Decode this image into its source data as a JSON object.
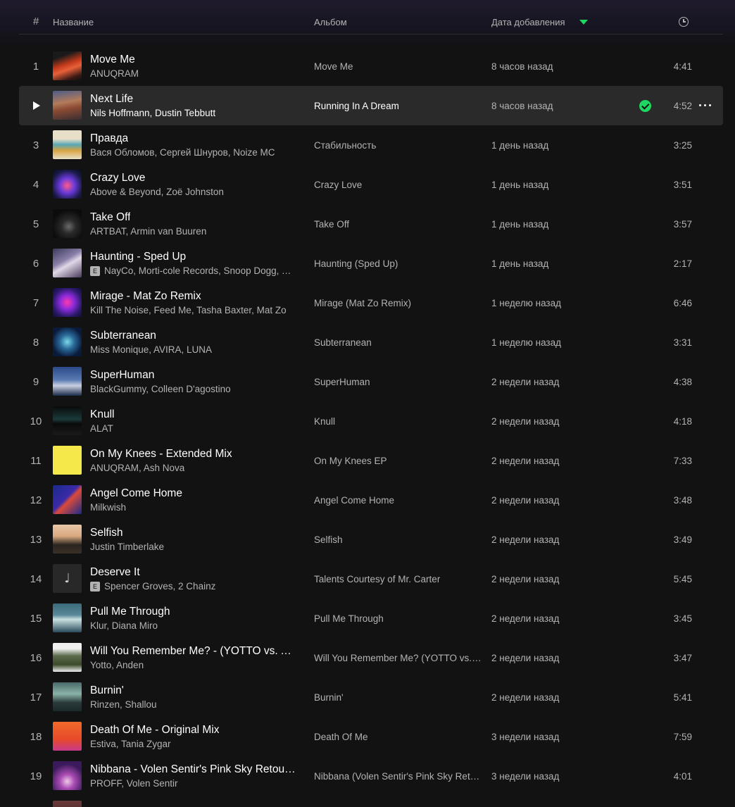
{
  "header": {
    "num": "#",
    "title": "Название",
    "album": "Альбом",
    "date": "Дата добавления"
  },
  "tracks": [
    {
      "num": "1",
      "title": "Move Me",
      "artist": "ANUQRAM",
      "album": "Move Me",
      "date": "8 часов назад",
      "duration": "4:41",
      "explicit": false,
      "cover": "linear-gradient(160deg,#1a1a1a 0%,#1a1a1a 20%,#c23a1a 45%,#e8603a 60%,#3a1a14 85%,#111 100%)"
    },
    {
      "num": "2",
      "title": "Next Life",
      "artist": "Nils Hoffmann, Dustin Tebbutt",
      "album": "Running In A Dream",
      "date": "8 часов назад",
      "duration": "4:52",
      "explicit": false,
      "active": true,
      "saved": true,
      "cover": "linear-gradient(170deg,#4a5c8a 0%,#b37b5a 40%,#8c4b33 60%,#3a2e30 100%)"
    },
    {
      "num": "3",
      "title": "Правда",
      "artist": "Вася Обломов, Сергей Шнуров, Noize MC",
      "album": "Стабильность",
      "date": "1 день назад",
      "duration": "3:25",
      "explicit": false,
      "cover": "linear-gradient(180deg,#e8dfc8 0%,#e8dfc8 30%,#58a6b3 50%,#d9a441 70%,#e8dfc8 100%)"
    },
    {
      "num": "4",
      "title": "Crazy Love",
      "artist": "Above & Beyond, Zoë Johnston",
      "album": "Crazy Love",
      "date": "1 день назад",
      "duration": "3:51",
      "explicit": false,
      "cover": "radial-gradient(circle at 50% 55%,#ff5a8a 0%,#6a3ad9 35%,#1a1a4a 70%,#0a0a1a 100%)"
    },
    {
      "num": "5",
      "title": "Take Off",
      "artist": "ARTBAT, Armin van Buuren",
      "album": "Take Off",
      "date": "1 день назад",
      "duration": "3:57",
      "explicit": false,
      "cover": "radial-gradient(circle at 55% 60%,#6a6a6a 0%,#2a2a2a 30%,#0c0c0c 70%)"
    },
    {
      "num": "6",
      "title": "Haunting - Sped Up",
      "artist": "NayCo, Morti-cole Records, Snoop Dogg, Trippie Redd",
      "album": "Haunting (Sped Up)",
      "date": "1 день назад",
      "duration": "2:17",
      "explicit": true,
      "cover": "linear-gradient(150deg,#3a3a5a 0%,#8a7fa8 40%,#e0d8e8 55%,#4a3a5a 100%)"
    },
    {
      "num": "7",
      "title": "Mirage - Mat Zo Remix",
      "artist": "Kill The Noise, Feed Me, Tasha Baxter, Mat Zo",
      "album": "Mirage (Mat Zo Remix)",
      "date": "1 неделю назад",
      "duration": "6:46",
      "explicit": false,
      "cover": "radial-gradient(circle at 50% 50%,#ff3ab0 0%,#8a2ad9 35%,#2a1a6a 70%,#120a3a 100%)"
    },
    {
      "num": "8",
      "title": "Subterranean",
      "artist": "Miss Monique, AVIRA, LUNA",
      "album": "Subterranean",
      "date": "1 неделю назад",
      "duration": "3:31",
      "explicit": false,
      "cover": "radial-gradient(circle at 50% 50%,#7ad9e8 0%,#2a6a9a 35%,#0a1a3a 75%)"
    },
    {
      "num": "9",
      "title": "SuperHuman",
      "artist": "BlackGummy, Colleen D'agostino",
      "album": "SuperHuman",
      "date": "2 недели назад",
      "duration": "4:38",
      "explicit": false,
      "cover": "linear-gradient(180deg,#2a4a8a 0%,#5a7ab3 45%,#c8d0e0 65%,#1a2a4a 100%)"
    },
    {
      "num": "10",
      "title": "Knull",
      "artist": "ALAT",
      "album": "Knull",
      "date": "2 недели назад",
      "duration": "4:18",
      "explicit": false,
      "cover": "linear-gradient(180deg,#0a0a0a 0%,#1a3a3a 45%,#0a0a0a 60%,#1a1a1a 100%)"
    },
    {
      "num": "11",
      "title": "On My Knees - Extended Mix",
      "artist": "ANUQRAM, Ash Nova",
      "album": "On My Knees EP",
      "date": "2 недели назад",
      "duration": "7:33",
      "explicit": false,
      "cover": "linear-gradient(180deg,#f5e84a 0%,#f5e84a 100%)"
    },
    {
      "num": "12",
      "title": "Angel Come Home",
      "artist": "Milkwish",
      "album": "Angel Come Home",
      "date": "2 недели назад",
      "duration": "3:48",
      "explicit": false,
      "cover": "linear-gradient(135deg,#1a2a8a 0%,#3a2aa8 45%,#d94a3a 55%,#1a2a8a 100%)"
    },
    {
      "num": "13",
      "title": "Selfish",
      "artist": "Justin Timberlake",
      "album": "Selfish",
      "date": "2 недели назад",
      "duration": "3:49",
      "explicit": false,
      "cover": "linear-gradient(180deg,#e8c8a8 0%,#d9a880 40%,#2a2420 70%,#3a3028 100%)"
    },
    {
      "num": "14",
      "title": "Deserve It",
      "artist": "Spencer Groves, 2 Chainz",
      "album": "Talents Courtesy of Mr. Carter",
      "date": "2 недели назад",
      "duration": "5:45",
      "explicit": true,
      "placeholder": true,
      "cover": "#282828"
    },
    {
      "num": "15",
      "title": "Pull Me Through",
      "artist": "Klur, Diana Miro",
      "album": "Pull Me Through",
      "date": "2 недели назад",
      "duration": "3:45",
      "explicit": false,
      "cover": "linear-gradient(180deg,#3a6a7a 0%,#5a8a9a 40%,#c8e0e0 55%,#2a4a5a 100%)"
    },
    {
      "num": "16",
      "title": "Will You Remember Me? - (YOTTO vs. Anden)",
      "artist": "Yotto, Anden",
      "album": "Will You Remember Me? (YOTTO vs. Anden)",
      "date": "2 недели назад",
      "duration": "3:47",
      "explicit": false,
      "cover": "linear-gradient(180deg,#f0f0f0 0%,#f0f0f0 20%,#5a6a4a 45%,#3a4a2a 75%,#f0f0f0 100%)"
    },
    {
      "num": "17",
      "title": "Burnin'",
      "artist": "Rinzen, Shallou",
      "album": "Burnin'",
      "date": "2 недели назад",
      "duration": "5:41",
      "explicit": false,
      "cover": "linear-gradient(180deg,#4a6a6a 0%,#8ab3a8 40%,#2a3a3a 70%,#1a2a2a 100%)"
    },
    {
      "num": "18",
      "title": "Death Of Me - Original Mix",
      "artist": "Estiva, Tania Zygar",
      "album": "Death Of Me",
      "date": "3 недели назад",
      "duration": "7:59",
      "explicit": false,
      "cover": "linear-gradient(180deg,#f06a2a 0%,#e84a2a 60%,#c83a8a 100%)"
    },
    {
      "num": "19",
      "title": "Nibbana - Volen Sentir's Pink Sky Retouch",
      "artist": "PROFF, Volen Sentir",
      "album": "Nibbana (Volen Sentir's Pink Sky Retouch)",
      "date": "3 недели назад",
      "duration": "4:01",
      "explicit": false,
      "cover": "radial-gradient(circle at 50% 70%,#f0c8e8 0%,#a84ab3 30%,#3a1a5a 70%)"
    },
    {
      "num": "20",
      "title": "",
      "artist": "",
      "album": "",
      "date": "",
      "duration": "",
      "explicit": false,
      "partial": true,
      "cover": "linear-gradient(180deg,#6a3a3a 0%,#3a1a1a 100%)"
    }
  ]
}
